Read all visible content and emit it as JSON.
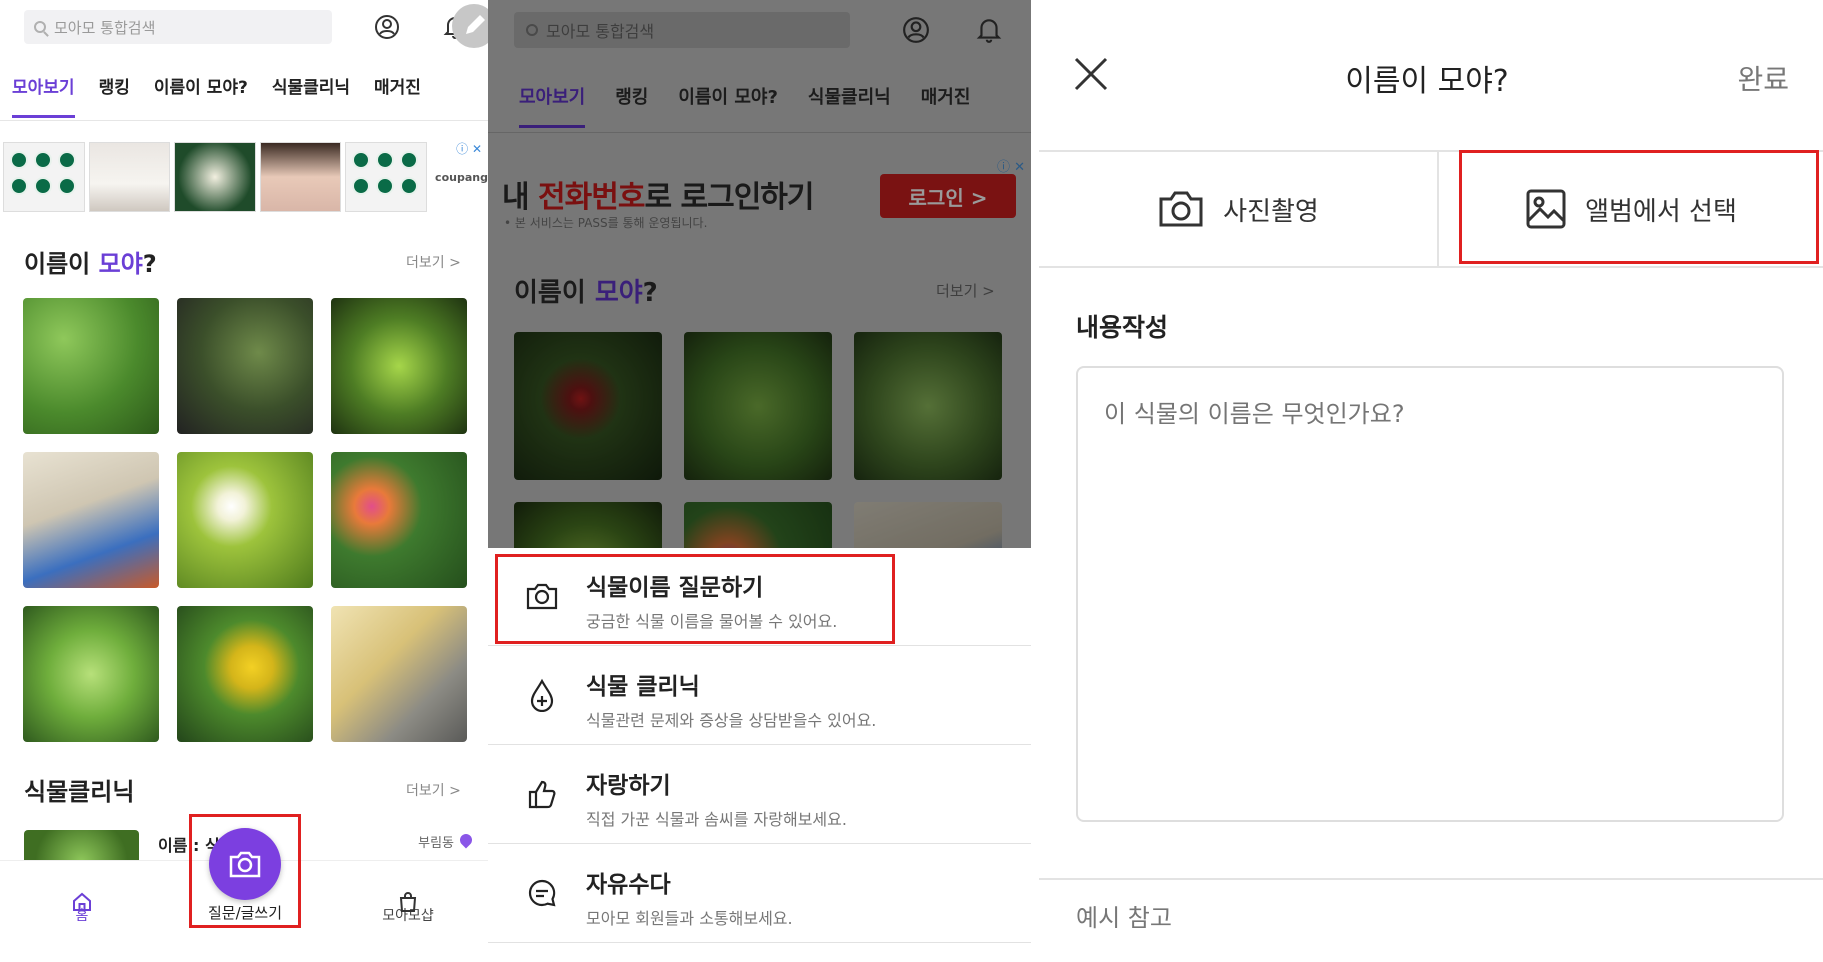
{
  "p1": {
    "search_placeholder": "모아모 통합검색",
    "tabs": [
      "모아보기",
      "랭킹",
      "이름이 모야?",
      "식물클리닉",
      "매거진"
    ],
    "ad_label": "coupang",
    "section1_title_a": "이름이 ",
    "section1_title_b": "모야",
    "section1_title_c": "?",
    "more": "더보기 >",
    "section2_title": "식물클리닉",
    "clinic_text": "이름 : 식",
    "clinic_location": "부림동",
    "nav": {
      "home": "홈",
      "write": "질문/글쓰기",
      "shop": "모아모샵"
    }
  },
  "p2": {
    "search_placeholder": "모아모 통합검색",
    "tabs": [
      "모아보기",
      "랭킹",
      "이름이 모야?",
      "식물클리닉",
      "매거진"
    ],
    "ad_a": "내 ",
    "ad_b": "전화번호",
    "ad_c": "로 로그인하기",
    "ad_sub": "• 본 서비스는 PASS를 통해 운영됩니다.",
    "ad_button": "로그인 >",
    "section_title_a": "이름이 ",
    "section_title_b": "모야",
    "section_title_c": "?",
    "more": "더보기 >",
    "menu": [
      {
        "title": "식물이름 질문하기",
        "sub": "궁금한 식물 이름을 물어볼 수 있어요.",
        "icon": "camera-icon"
      },
      {
        "title": "식물 클리닉",
        "sub": "식물관련 문제와 증상을 상담받을수 있어요.",
        "icon": "drop-plus-icon"
      },
      {
        "title": "자랑하기",
        "sub": "직접 가꾼 식물과 솜씨를 자랑해보세요.",
        "icon": "thumbs-up-icon"
      },
      {
        "title": "자유수다",
        "sub": "모아모 회원들과 소통해보세요.",
        "icon": "chat-icon"
      }
    ]
  },
  "p3": {
    "title": "이름이 모야?",
    "done": "완료",
    "camera_label": "사진촬영",
    "album_label": "앨범에서 선택",
    "content_label": "내용작성",
    "content_placeholder": "이 식물의 이름은 무엇인가요?",
    "example": "예시 참고"
  },
  "colors": {
    "accent": "#6b3fd6",
    "highlight": "#e02020",
    "fab": "#7c3fe0"
  }
}
